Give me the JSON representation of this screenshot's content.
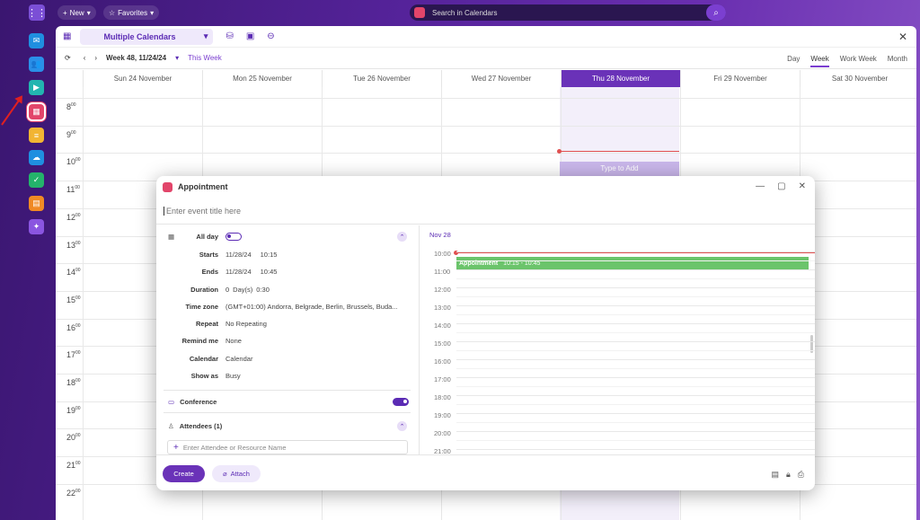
{
  "topbar": {
    "new_label": "New",
    "favorites_label": "Favorites",
    "search_placeholder": "Search in Calendars"
  },
  "sidebar": {
    "apps": [
      {
        "name": "mail",
        "color": "#1f8fe0",
        "glyph": "✉"
      },
      {
        "name": "contacts",
        "color": "#2a90e8",
        "glyph": "👥"
      },
      {
        "name": "meetings",
        "color": "#22b5b0",
        "glyph": "▶"
      },
      {
        "name": "calendar",
        "color": "#e2456a",
        "glyph": "▦"
      },
      {
        "name": "notes",
        "color": "#f2b533",
        "glyph": "≡"
      },
      {
        "name": "storage",
        "color": "#1f8fe0",
        "glyph": "☁"
      },
      {
        "name": "tasks",
        "color": "#24b36b",
        "glyph": "✓"
      },
      {
        "name": "reports",
        "color": "#f08a24",
        "glyph": "▤"
      },
      {
        "name": "flow",
        "color": "#8a55e0",
        "glyph": "✦"
      }
    ]
  },
  "calendar": {
    "selector": "Multiple Calendars",
    "week_label": "Week 48, 11/24/24",
    "this_week": "This Week",
    "views": [
      "Day",
      "Week",
      "Work Week",
      "Month"
    ],
    "active_view": "Week",
    "days": [
      "Sun 24 November",
      "Mon 25 November",
      "Tue 26 November",
      "Wed 27 November",
      "Thu 28 November",
      "Fri 29 November",
      "Sat 30 November"
    ],
    "today_index": 4,
    "hours": [
      "8",
      "9",
      "10",
      "11",
      "12",
      "13",
      "14",
      "15",
      "16",
      "17",
      "18",
      "19",
      "20",
      "21",
      "22"
    ],
    "hour_suffix": "00",
    "type_to_add": "Type to Add"
  },
  "dialog": {
    "title": "Appointment",
    "event_title_placeholder": "Enter event title here",
    "all_day_label": "All day",
    "all_day": false,
    "fields": [
      {
        "label": "Starts",
        "date": "11/28/24",
        "time": "10:15"
      },
      {
        "label": "Ends",
        "date": "11/28/24",
        "time": "10:45"
      }
    ],
    "duration": {
      "label": "Duration",
      "value": "0",
      "unit": "Day(s)",
      "time": "0:30"
    },
    "timezone": {
      "label": "Time zone",
      "value": "(GMT+01:00) Andorra, Belgrade, Berlin, Brussels, Buda..."
    },
    "repeat": {
      "label": "Repeat",
      "value": "No Repeating"
    },
    "remind": {
      "label": "Remind me",
      "value": "None"
    },
    "calendar": {
      "label": "Calendar",
      "value": "Calendar"
    },
    "show_as": {
      "label": "Show as",
      "value": "Busy"
    },
    "conference_label": "Conference",
    "conference": true,
    "attendees_label": "Attendees (1)",
    "attendee_placeholder": "Enter Attendee or Resource Name",
    "create_label": "Create",
    "attach_label": "Attach",
    "schedule": {
      "date": "Nov 28",
      "times": [
        "10:00",
        "11:00",
        "12:00",
        "13:00",
        "14:00",
        "15:00",
        "16:00",
        "17:00",
        "18:00",
        "19:00",
        "20:00",
        "21:00"
      ],
      "event_title": "Appointment",
      "event_time": "10:15 - 10:45"
    }
  },
  "colors": {
    "accent": "#6a32b8",
    "event": "#6bc46b",
    "now": "#e05050"
  }
}
